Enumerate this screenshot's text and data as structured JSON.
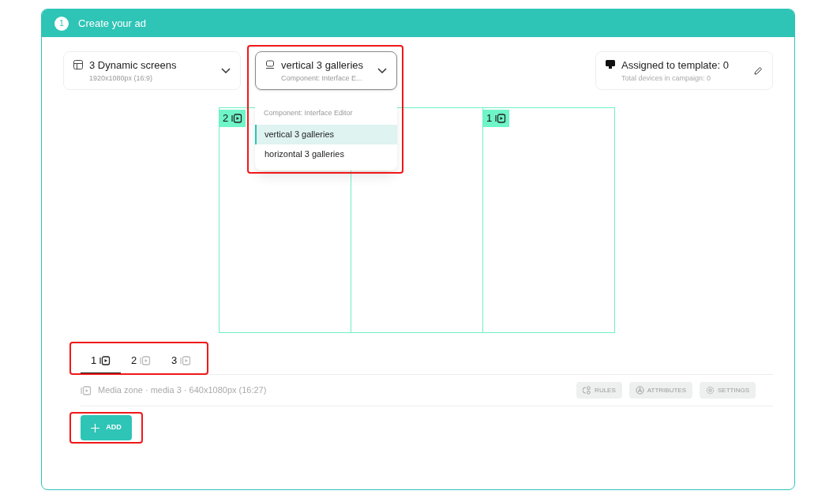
{
  "header": {
    "step": "1",
    "title": "Create your ad"
  },
  "screen_selector": {
    "title": "3 Dynamic screens",
    "subtitle": "1920x1080px (16:9)"
  },
  "layout_selector": {
    "title": "vertical 3 galleries",
    "subtitle": "Component: Interface E...",
    "expanded": true,
    "menu": {
      "heading": "Component: Interface Editor",
      "options": [
        {
          "label": "vertical 3 galleries",
          "selected": true
        },
        {
          "label": "horizontal 3 galleries",
          "selected": false
        }
      ]
    }
  },
  "devices": {
    "title": "Assigned to template: 0",
    "subtitle": "Total devices in campaign: 0"
  },
  "zones": [
    {
      "label": "2"
    },
    {
      "covered": true
    },
    {
      "label": "1"
    }
  ],
  "zone_tabs": [
    {
      "label": "1",
      "selected": true
    },
    {
      "label": "2",
      "selected": false
    },
    {
      "label": "3",
      "selected": false
    }
  ],
  "zone_info": "Media zone · media 3 · 640x1080px (16:27)",
  "zone_actions": [
    {
      "kind": "rules",
      "label": "RULES"
    },
    {
      "kind": "attributes",
      "label": "ATTRIBUTES"
    },
    {
      "kind": "settings",
      "label": "SETTINGS"
    }
  ],
  "add_button": "ADD"
}
